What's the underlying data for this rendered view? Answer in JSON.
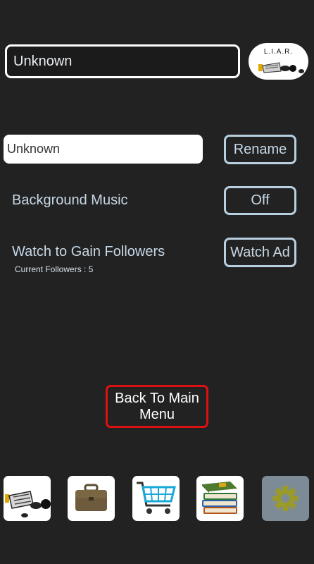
{
  "header": {
    "player_name": "Unknown",
    "logo_text": "L.I.A.R."
  },
  "settings": {
    "rename_input_value": "Unknown",
    "rename_button": "Rename",
    "music_label": "Background Music",
    "music_toggle": "Off",
    "watch_label": "Watch to Gain Followers",
    "watch_button": "Watch Ad",
    "followers_text": "Current Followers : 5"
  },
  "back_button": "Back To Main Menu",
  "nav": {
    "tabs": [
      {
        "icon": "newspaper-scene-icon"
      },
      {
        "icon": "briefcase-icon"
      },
      {
        "icon": "shopping-cart-icon"
      },
      {
        "icon": "books-icon"
      },
      {
        "icon": "gear-icon",
        "active": true
      }
    ]
  },
  "colors": {
    "background": "#222222",
    "text_accent": "#c7d8e6",
    "back_button_border": "#dd1111",
    "gear": "#9a9a2a"
  }
}
